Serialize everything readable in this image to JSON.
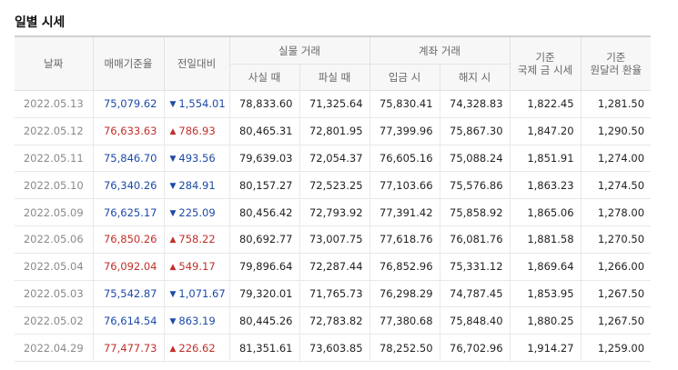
{
  "title": "일별 시세",
  "headers": {
    "date": "날짜",
    "base_rate": "매매기준율",
    "change": "전일대비",
    "real_group": "실물 거래",
    "real_buy": "사실 때",
    "real_sell": "파실 때",
    "transfer_group": "계좌 거래",
    "transfer_in": "입금 시",
    "transfer_out": "해지 시",
    "intl_line1": "기준",
    "intl_line2": "국제 금 시세",
    "usd_line1": "기준",
    "usd_line2": "원달러 환율"
  },
  "colors": {
    "up": "#c0302b",
    "down": "#1d4aa8"
  },
  "rows": [
    {
      "date": "2022.05.13",
      "base": "75,079.62",
      "dir": "down",
      "arrow": "▼",
      "change": "1,554.01",
      "real_buy": "78,833.60",
      "real_sell": "71,325.64",
      "in": "75,830.41",
      "out": "74,328.83",
      "intl": "1,822.45",
      "usd": "1,281.50"
    },
    {
      "date": "2022.05.12",
      "base": "76,633.63",
      "dir": "up",
      "arrow": "▲",
      "change": "786.93",
      "real_buy": "80,465.31",
      "real_sell": "72,801.95",
      "in": "77,399.96",
      "out": "75,867.30",
      "intl": "1,847.20",
      "usd": "1,290.50"
    },
    {
      "date": "2022.05.11",
      "base": "75,846.70",
      "dir": "down",
      "arrow": "▼",
      "change": "493.56",
      "real_buy": "79,639.03",
      "real_sell": "72,054.37",
      "in": "76,605.16",
      "out": "75,088.24",
      "intl": "1,851.91",
      "usd": "1,274.00"
    },
    {
      "date": "2022.05.10",
      "base": "76,340.26",
      "dir": "down",
      "arrow": "▼",
      "change": "284.91",
      "real_buy": "80,157.27",
      "real_sell": "72,523.25",
      "in": "77,103.66",
      "out": "75,576.86",
      "intl": "1,863.23",
      "usd": "1,274.50"
    },
    {
      "date": "2022.05.09",
      "base": "76,625.17",
      "dir": "down",
      "arrow": "▼",
      "change": "225.09",
      "real_buy": "80,456.42",
      "real_sell": "72,793.92",
      "in": "77,391.42",
      "out": "75,858.92",
      "intl": "1,865.06",
      "usd": "1,278.00"
    },
    {
      "date": "2022.05.06",
      "base": "76,850.26",
      "dir": "up",
      "arrow": "▲",
      "change": "758.22",
      "real_buy": "80,692.77",
      "real_sell": "73,007.75",
      "in": "77,618.76",
      "out": "76,081.76",
      "intl": "1,881.58",
      "usd": "1,270.50"
    },
    {
      "date": "2022.05.04",
      "base": "76,092.04",
      "dir": "up",
      "arrow": "▲",
      "change": "549.17",
      "real_buy": "79,896.64",
      "real_sell": "72,287.44",
      "in": "76,852.96",
      "out": "75,331.12",
      "intl": "1,869.64",
      "usd": "1,266.00"
    },
    {
      "date": "2022.05.03",
      "base": "75,542.87",
      "dir": "down",
      "arrow": "▼",
      "change": "1,071.67",
      "real_buy": "79,320.01",
      "real_sell": "71,765.73",
      "in": "76,298.29",
      "out": "74,787.45",
      "intl": "1,853.95",
      "usd": "1,267.50"
    },
    {
      "date": "2022.05.02",
      "base": "76,614.54",
      "dir": "down",
      "arrow": "▼",
      "change": "863.19",
      "real_buy": "80,445.26",
      "real_sell": "72,783.82",
      "in": "77,380.68",
      "out": "75,848.40",
      "intl": "1,880.25",
      "usd": "1,267.50"
    },
    {
      "date": "2022.04.29",
      "base": "77,477.73",
      "dir": "up",
      "arrow": "▲",
      "change": "226.62",
      "real_buy": "81,351.61",
      "real_sell": "73,603.85",
      "in": "78,252.50",
      "out": "76,702.96",
      "intl": "1,914.27",
      "usd": "1,259.00"
    }
  ]
}
